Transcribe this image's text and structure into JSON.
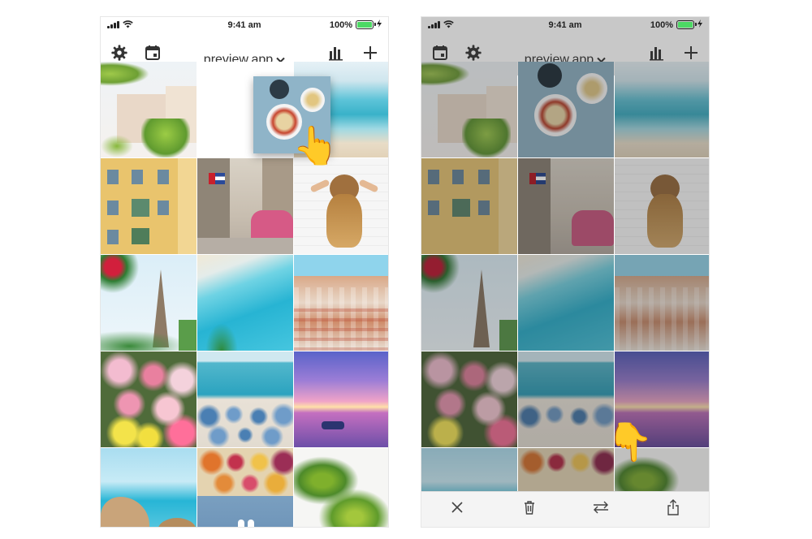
{
  "status_bar": {
    "time": "9:41 am",
    "battery_text": "100%",
    "battery_level": 1.0
  },
  "toolbar": {
    "title": "preview.app"
  },
  "colors": {
    "accent_battery": "#4cd964",
    "icon": "#333333"
  },
  "icons": {
    "left_toolbar": [
      "gear-icon",
      "calendar-icon",
      "chevron-down-icon",
      "bar-chart-icon",
      "plus-icon"
    ],
    "right_toolbar": [
      "calendar-icon",
      "gear-icon",
      "chevron-down-icon",
      "bar-chart-icon",
      "plus-icon"
    ],
    "bottom_bar": [
      "close-icon",
      "trash-icon",
      "swap-icon",
      "share-icon"
    ],
    "gesture": "pointing-hand-icon"
  },
  "grid_left": [
    "palm-building",
    "empty-slot",
    "ocean-beach",
    "yellow-building",
    "cuba-street",
    "woman-hair",
    "eiffel-tower",
    "blue-beach",
    "coastal-town",
    "flowers",
    "umbrella-beach",
    "purple-sunset",
    "coast-rocks",
    "food-market",
    "palm-leaves"
  ],
  "grid_right": [
    "palm-building",
    "breakfast",
    "ocean-beach",
    "yellow-building",
    "cuba-street",
    "woman-hair",
    "eiffel-tower",
    "blue-beach",
    "coastal-town",
    "flowers",
    "umbrella-beach",
    "purple-sunset",
    "coast-rocks",
    "food-market",
    "palm-leaves"
  ]
}
